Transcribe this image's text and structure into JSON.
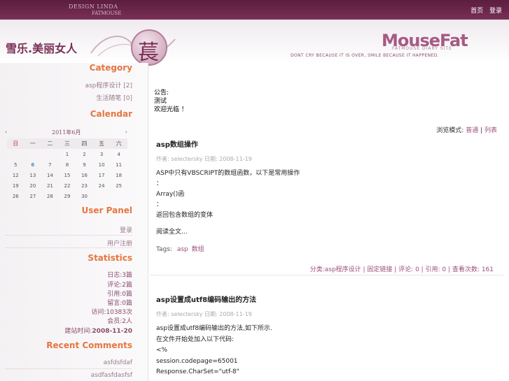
{
  "header": {
    "design_credit": "DESIGN LINDA",
    "design_sub": "FATMOUSE",
    "top_links": [
      "首页",
      "登录"
    ],
    "emblem_char": "萇",
    "site_title": "雪乐.美丽女人",
    "logo": "MouseFat",
    "logo_sub": "FATMOUSE DIARY SITE",
    "tagline": "DONT CRY BECAUSE IT IS OVER, SMILE BECAUSE IT HAPPENED."
  },
  "sidebar": {
    "category_title": "Category",
    "categories": [
      "asp程序设计 [2]",
      "生活随笔 [0]"
    ],
    "calendar_title": "Calendar",
    "calendar": {
      "month_label": "2011年6月",
      "prev": "‹",
      "next": "›",
      "weekdays": [
        "日",
        "一",
        "二",
        "三",
        "四",
        "五",
        "六"
      ],
      "rows": [
        [
          "",
          "",
          "",
          "1",
          "2",
          "3",
          "4"
        ],
        [
          "5",
          "6",
          "7",
          "8",
          "9",
          "10",
          "11"
        ],
        [
          "12",
          "13",
          "14",
          "15",
          "16",
          "17",
          "18"
        ],
        [
          "19",
          "20",
          "21",
          "22",
          "23",
          "24",
          "25"
        ],
        [
          "26",
          "27",
          "28",
          "29",
          "30",
          "",
          ""
        ]
      ],
      "today": "6"
    },
    "user_panel_title": "User Panel",
    "user_links": [
      "登录",
      "用户注册"
    ],
    "statistics_title": "Statistics",
    "stats": [
      "日志:3篇",
      "评论:2篇",
      "引用:0篇",
      "留言:0篇",
      "访问:10383次",
      "会员:2人"
    ],
    "stats_since_label": "建站时间:",
    "stats_since": "2008-11-20",
    "recent_comments_title": "Recent Comments",
    "recent_comments": [
      "asfdsfdaf",
      "asdfasfdasfsf"
    ]
  },
  "main": {
    "notice": [
      "公告:",
      "测试",
      "欢迎光临 ！"
    ],
    "view_mode_label": "浏览模式:",
    "view_mode_normal": "普通",
    "view_mode_list": "列表",
    "posts": [
      {
        "title": "asp数组操作",
        "meta_author_label": "作者:",
        "meta_author": "selectersky",
        "meta_date_label": "日期:",
        "meta_date": "2008-11-19",
        "body": [
          "ASP中只有VBSCRIPT的数组函数，以下是常用操作",
          "：",
          "Array()函",
          "：",
          "返回包含数组的变体"
        ],
        "more": "阅读全文...",
        "tags_label": "Tags:",
        "tags": [
          "asp",
          "数组"
        ],
        "footer": "分类:asp程序设计 | 固定链接 | 评论: 0 | 引用: 0 | 查看次数: 161"
      },
      {
        "title": "asp设置成utf8编码输出的方法",
        "meta_author_label": "作者:",
        "meta_author": "selectersky",
        "meta_date_label": "日期:",
        "meta_date": "2008-11-19",
        "body": [
          "asp设置成utf8编码输出的方法,如下所示.",
          "在文件开始处加入以下代码:",
          "<%",
          "session.codepage=65001",
          "Response.CharSet=\"utf-8\""
        ]
      }
    ]
  },
  "colors": {
    "header_bar": "#5b1d3f",
    "sidebar_title": "#e5763f",
    "link": "#9a4f78"
  }
}
